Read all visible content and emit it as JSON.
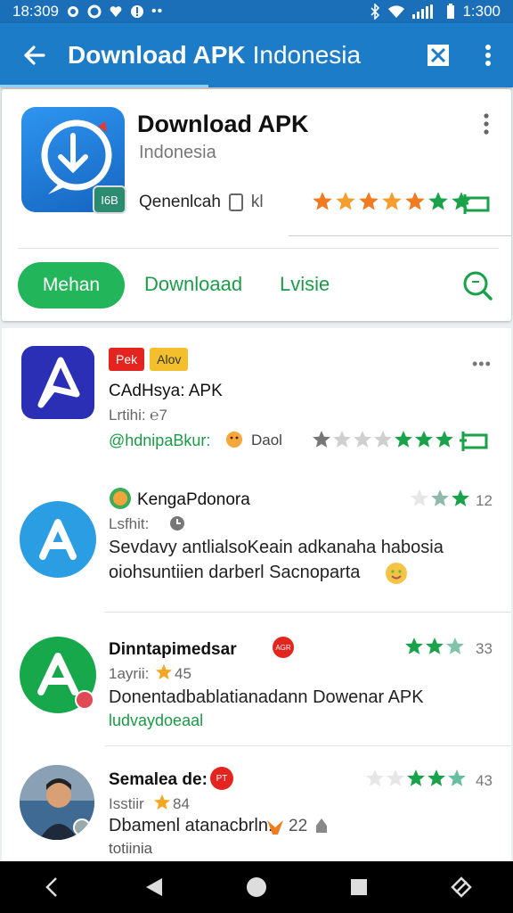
{
  "status_bar": {
    "time": "18:309",
    "battery_time": "1:300"
  },
  "app_bar": {
    "title_bold": "Download APK",
    "title_light": "Indonesia"
  },
  "hero": {
    "title": "Download APK",
    "subtitle": "Indonesia",
    "badge": "I6B",
    "meta_a": "Qenenlcah",
    "meta_b": "kl",
    "star_colors": [
      "#f07b23",
      "#f59d2d",
      "#f07b23",
      "#f59d2d",
      "#f07b23",
      "#1aa24b",
      "#1aa24b"
    ]
  },
  "tabs": {
    "primary": "Mehan",
    "download": "Downloaad",
    "third": "Lvisie"
  },
  "list": [
    {
      "tags": [
        "Pek",
        "Alov"
      ],
      "title": "CAdHsya: APK",
      "sub": "Lrtihi: ℮7",
      "green": "@hdnipaBkur:",
      "extra": "Dаol",
      "star_colors": [
        "#777",
        "#cfcfcf",
        "#cfcfcf",
        "#cfcfcf",
        "#1aa24b",
        "#1aa24b",
        "#1aa24b"
      ],
      "count": ""
    },
    {
      "title": "KengaPdonora",
      "sub": "Lsfhit:",
      "body1": "Sevdavy antlialsoKeain adkanaha habosia",
      "body2": "oiohsuntiien darberl Sacnoparta",
      "star_colors": [
        "#e6e6e6",
        "#8fb9ad",
        "#1aa24b"
      ],
      "count": "12"
    },
    {
      "title": "Dinntapimedsar",
      "badge": "AGR",
      "sub": "1ayrii:",
      "sub_num": "45",
      "body1": "Donentadbablatianadann Dowenar APK",
      "green": "ludvaydoeaal",
      "star_colors": [
        "#1aa24b",
        "#1aa24b",
        "#7fc3a9"
      ],
      "count": "33"
    },
    {
      "title": "Semalea de:",
      "badge": "PT",
      "sub": "Isstiir",
      "sub_num": "84",
      "body1": "Dbamenl atanacbrln.",
      "body_num": "22",
      "extra": "totiinia",
      "star_colors": [
        "#e6e6e6",
        "#e6e6e6",
        "#1aa24b",
        "#1aa24b",
        "#6bbfa1"
      ],
      "count": "43"
    }
  ],
  "icons": {
    "back": "arrow-left-icon",
    "close": "close-box-icon",
    "more": "more-vert-icon",
    "search": "search-icon",
    "flag": "flag-icon"
  }
}
